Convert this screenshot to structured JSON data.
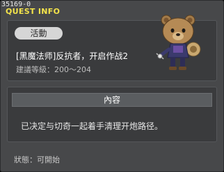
{
  "window": {
    "quest_id": "35169-0",
    "title": "QUEST INFO"
  },
  "quest": {
    "category_badge": "活動",
    "name": "[黑魔法师]反抗者，开启作战2",
    "level_requirement": "建議等級：200～204"
  },
  "npc": {
    "icon": "bear-npc-icon"
  },
  "content": {
    "header": "內容",
    "text": "已决定与切奇一起着手清理开炮路径。"
  },
  "status": {
    "text": "狀態：可開始"
  },
  "colors": {
    "title": "#f4e44a",
    "panel_bg": "#47484a",
    "box_bg": "#3a3b3d"
  }
}
